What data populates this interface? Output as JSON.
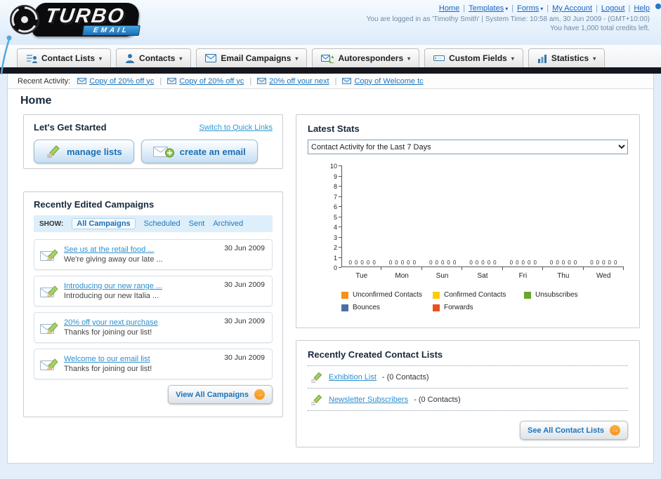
{
  "header": {
    "logo_title": "TURBO",
    "logo_subtitle": "EMAIL",
    "nav_links": [
      {
        "label": "Home",
        "caret": false
      },
      {
        "label": "Templates",
        "caret": true
      },
      {
        "label": "Forms",
        "caret": true
      },
      {
        "label": "My Account",
        "caret": false
      },
      {
        "label": "Logout",
        "caret": false
      },
      {
        "label": "Help",
        "caret": false
      }
    ],
    "login_info": "You are logged in as 'Timothy Smith' | System Time: 10:58 am, 30 Jun 2009 - (GMT+10:00)",
    "credits_info": "You have 1,000 total credits left."
  },
  "icons": {
    "caret_down": "▾",
    "arrow_right": "→",
    "pipe": "|"
  },
  "colors": {
    "accent_blue": "#1c74bb",
    "dark_bar": "#15151d",
    "button_orange": "#f7941e"
  },
  "nav": {
    "items": [
      {
        "label": "Contact Lists"
      },
      {
        "label": "Contacts"
      },
      {
        "label": "Email Campaigns"
      },
      {
        "label": "Autoresponders"
      },
      {
        "label": "Custom Fields"
      },
      {
        "label": "Statistics"
      }
    ]
  },
  "recent_activity": {
    "label": "Recent Activity:",
    "items": [
      "Copy of 20% off yc",
      "Copy of 20% off yc",
      "20% off your next",
      "Copy of Welcome tc"
    ]
  },
  "page_title": "Home",
  "get_started": {
    "title": "Let's Get Started",
    "switch_link": "Switch to Quick Links",
    "buttons": [
      {
        "label": "manage lists"
      },
      {
        "label": "create an email"
      }
    ]
  },
  "campaigns": {
    "title": "Recently Edited Campaigns",
    "show_label": "SHOW:",
    "tabs": [
      "All Campaigns",
      "Scheduled",
      "Sent",
      "Archived"
    ],
    "items": [
      {
        "title": "See us at the retail food ...",
        "subtitle": "We're giving away our late ...",
        "date": "30 Jun 2009"
      },
      {
        "title": "Introducing our new range ...",
        "subtitle": "Introducing our new Italia ...",
        "date": "30 Jun 2009"
      },
      {
        "title": "20% off your next purchase",
        "subtitle": "Thanks for joining our list!",
        "date": "30 Jun 2009"
      },
      {
        "title": "Welcome to our email list",
        "subtitle": "Thanks for joining our list!",
        "date": "30 Jun 2009"
      }
    ],
    "view_all_label": "View All Campaigns"
  },
  "stats": {
    "title": "Latest Stats",
    "dropdown_value": "Contact Activity for the Last 7 Days",
    "chart_data": {
      "type": "bar",
      "title": "Contact Activity for the Last 7 Days",
      "categories": [
        "Tue",
        "Mon",
        "Sun",
        "Sat",
        "Fri",
        "Thu",
        "Wed"
      ],
      "series": [
        {
          "name": "Unconfirmed Contacts",
          "color": "#f78f1e",
          "values": [
            0,
            0,
            0,
            0,
            0,
            0,
            0
          ]
        },
        {
          "name": "Confirmed Contacts",
          "color": "#ffcb05",
          "values": [
            0,
            0,
            0,
            0,
            0,
            0,
            0
          ]
        },
        {
          "name": "Unsubscribes",
          "color": "#6aa62e",
          "values": [
            0,
            0,
            0,
            0,
            0,
            0,
            0
          ]
        },
        {
          "name": "Bounces",
          "color": "#4a6fa5",
          "values": [
            0,
            0,
            0,
            0,
            0,
            0,
            0
          ]
        },
        {
          "name": "Forwards",
          "color": "#e8511e",
          "values": [
            0,
            0,
            0,
            0,
            0,
            0,
            0
          ]
        }
      ],
      "ylim": [
        0,
        10
      ],
      "ytick_step": 1,
      "grid": false,
      "legend_position": "bottom",
      "value_labels_shown": true
    }
  },
  "contact_lists": {
    "title": "Recently Created Contact Lists",
    "items": [
      {
        "name": "Exhibition List",
        "detail": "- (0 Contacts)"
      },
      {
        "name": "Newsletter Subscribers",
        "detail": "- (0 Contacts)"
      }
    ],
    "see_all_label": "See All Contact Lists"
  }
}
